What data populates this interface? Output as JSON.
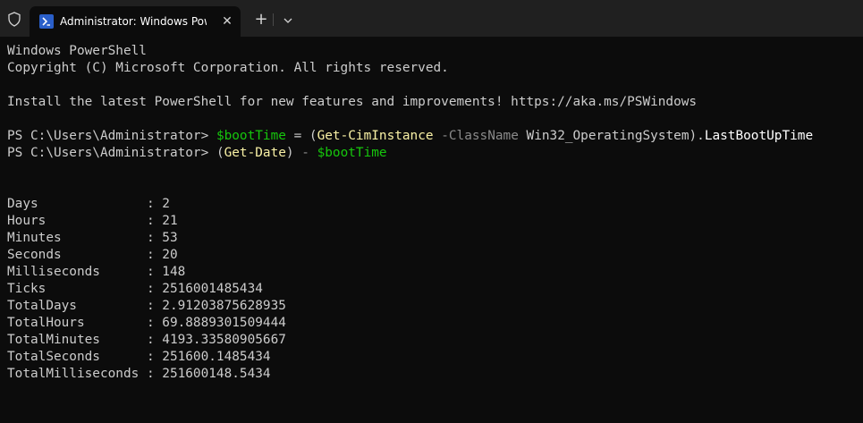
{
  "window": {
    "tab_title": "Administrator: Windows PowerShell",
    "tab_close_glyph": "✕",
    "new_tab_glyph": "+"
  },
  "console": {
    "banner": [
      "Windows PowerShell",
      "Copyright (C) Microsoft Corporation. All rights reserved.",
      "",
      "Install the latest PowerShell for new features and improvements! https://aka.ms/PSWindows",
      ""
    ],
    "prompt": "PS C:\\Users\\Administrator> ",
    "cmd1": {
      "var": "$bootTime",
      "eq": " = ",
      "open": "(",
      "cmdlet": "Get-CimInstance",
      "sp1": " ",
      "param": "-ClassName",
      "arg": " Win32_OperatingSystem",
      "close": ").",
      "prop": "LastBootUpTime"
    },
    "cmd2": {
      "open": "(",
      "cmdlet": "Get-Date",
      "close": ")",
      "op": " - ",
      "var": "$bootTime"
    },
    "output": [
      "Days              : 2",
      "Hours             : 21",
      "Minutes           : 53",
      "Seconds           : 20",
      "Milliseconds      : 148",
      "Ticks             : 2516001485434",
      "TotalDays         : 2.91203875628935",
      "TotalHours        : 69.8889301509444",
      "TotalMinutes      : 4193.33580905667",
      "TotalSeconds      : 251600.1485434",
      "TotalMilliseconds : 251600148.5434"
    ]
  },
  "colors": {
    "background": "#0c0c0c",
    "titlebar": "#202020",
    "variable": "#16c60c",
    "cmdlet": "#f9f1a5",
    "parameter": "#8a8a8a"
  }
}
